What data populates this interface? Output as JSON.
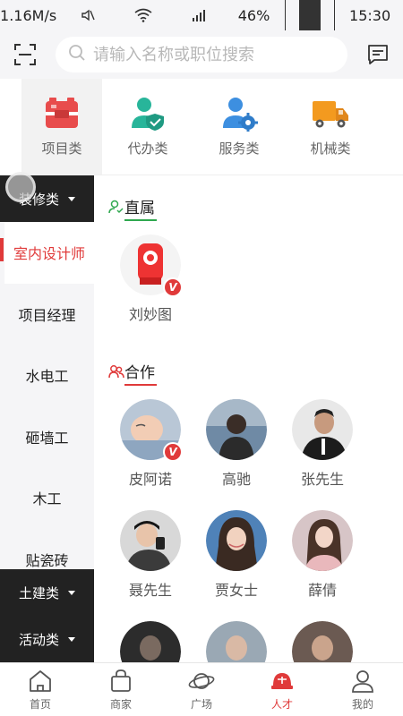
{
  "status_bar": {
    "speed": "1.16M/s",
    "signal_label": "46%",
    "time": "15:30"
  },
  "header": {
    "search_placeholder": "请输入名称或职位搜索"
  },
  "categories": [
    {
      "label": "项目类",
      "icon": "toolbox-icon",
      "color": "#e84c4c"
    },
    {
      "label": "代办类",
      "icon": "user-shield-icon",
      "color": "#28b59a"
    },
    {
      "label": "服务类",
      "icon": "user-gear-icon",
      "color": "#3d8fe0"
    },
    {
      "label": "机械类",
      "icon": "truck-icon",
      "color": "#f39a1f"
    }
  ],
  "sidebar": {
    "section_top": "装修类",
    "items": [
      "室内设计师",
      "项目经理",
      "水电工",
      "砸墙工",
      "木工",
      "贴瓷砖"
    ],
    "section_mid": "土建类",
    "section_bottom": "活动类"
  },
  "main": {
    "direct_title": "直属",
    "direct_people": [
      {
        "name": "刘妙图",
        "verified": true
      }
    ],
    "coop_title": "合作",
    "coop_people": [
      {
        "name": "皮阿诺",
        "verified": true
      },
      {
        "name": "高驰",
        "verified": false
      },
      {
        "name": "张先生",
        "verified": false
      },
      {
        "name": "聂先生",
        "verified": false
      },
      {
        "name": "贾女士",
        "verified": false
      },
      {
        "name": "薛倩",
        "verified": false
      }
    ],
    "verified_badge": "V"
  },
  "bottom_nav": [
    {
      "label": "首页",
      "icon": "home-icon"
    },
    {
      "label": "商家",
      "icon": "shopping-bag-icon"
    },
    {
      "label": "广场",
      "icon": "planet-icon"
    },
    {
      "label": "人才",
      "icon": "helmet-icon",
      "active": true
    },
    {
      "label": "我的",
      "icon": "user-icon"
    }
  ],
  "colors": {
    "accent": "#e03a3a",
    "green": "#2fa84f",
    "dark": "#222222"
  }
}
